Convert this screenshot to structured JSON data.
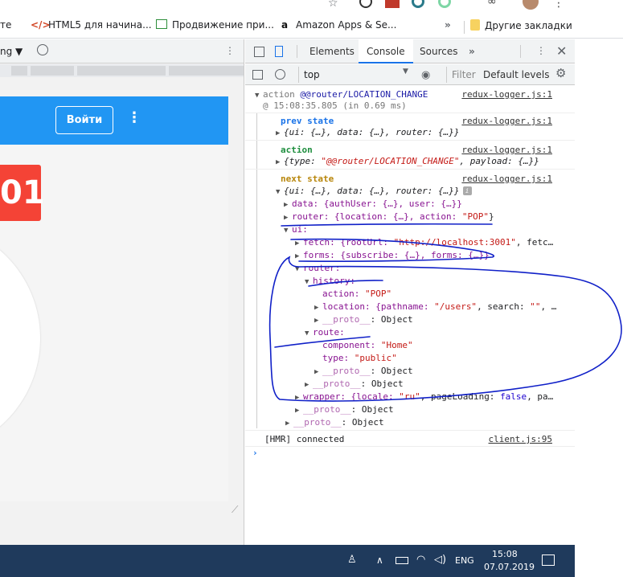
{
  "browser": {
    "bookmarks": [
      {
        "label": "те",
        "icon": "none"
      },
      {
        "label": "HTML5 для начина...",
        "icon": "code-icon"
      },
      {
        "label": "Продвижение при...",
        "icon": "chart-icon"
      },
      {
        "label": "Amazon Apps & Se...",
        "icon": "amazon-icon"
      }
    ],
    "more": "»",
    "other_bookmarks": "Другие закладки"
  },
  "viewport": {
    "device_label": "ng ▼",
    "app_login_label": "Войти",
    "badge_text": "01"
  },
  "devtools": {
    "tabs": {
      "elements": "Elements",
      "console": "Console",
      "sources": "Sources",
      "more": "»"
    },
    "context": "top",
    "filter_placeholder": "Filter",
    "levels": "Default levels",
    "log": {
      "action_prefix": "action",
      "action_type": "@@router/LOCATION_CHANGE",
      "action_time": "@ 15:08:35.805 (in 0.69 ms)",
      "source": "redux-logger.js:1",
      "prev_state_label": "prev state",
      "prev_state_value": "{ui: {…}, data: {…}, router: {…}}",
      "action_label": "action",
      "action_value_prefix": "{type: ",
      "action_value_type": "\"@@router/LOCATION_CHANGE\"",
      "action_value_suffix": ", payload: {…}}",
      "next_state_label": "next state",
      "next_state_value": "{ui: {…}, data: {…}, router: {…}}",
      "data_line": "data: {authUser: {…}, user: {…}}",
      "router_line_pre": "router: {location: {…}, action: ",
      "router_line_str": "\"POP\"",
      "router_line_post": "}",
      "ui_line": "ui:",
      "fetch_pre": "fetch: {rootUrl: ",
      "fetch_str": "\"http://localhost:3001\"",
      "fetch_post": ", fetc…",
      "forms_line": "forms: {subscribe: {…}, forms: {…}}",
      "router_key": "router:",
      "history_key": "history:",
      "history_action_key": "action: ",
      "history_action_val": "\"POP\"",
      "location_pre": "location: {pathname: ",
      "location_str": "\"/users\"",
      "location_mid": ", search: ",
      "location_str2": "\"\"",
      "location_post": ", …",
      "proto_key": "__proto__",
      "proto_val": ": Object",
      "route_key": "route:",
      "component_key": "component: ",
      "component_val": "\"Home\"",
      "type_key": "type: ",
      "type_val": "\"public\"",
      "wrapper_pre": "wrapper: {locale: ",
      "wrapper_str": "\"ru\"",
      "wrapper_mid": ", pageLoading: ",
      "wrapper_bool": "false",
      "wrapper_post": ", pa…",
      "hmr": "[HMR] connected",
      "hmr_source": "client.js:95"
    }
  },
  "taskbar": {
    "lang": "ENG",
    "time": "15:08",
    "date": "07.07.2019"
  },
  "colors": {
    "app_bar": "#2196f3",
    "badge": "#f44336",
    "ink": "#1020c8",
    "taskbar": "#1f3a5c"
  }
}
